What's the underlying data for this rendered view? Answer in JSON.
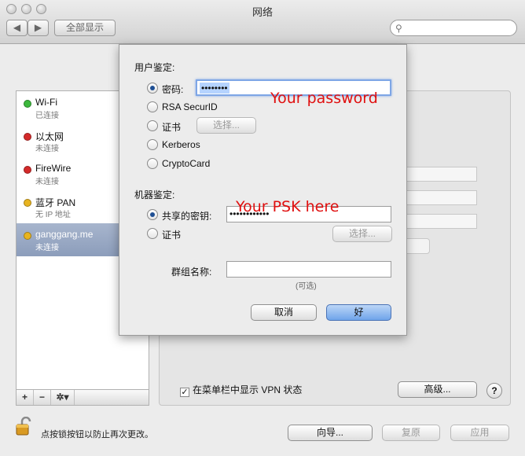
{
  "window": {
    "title": "网络"
  },
  "toolbar": {
    "back_label": "◀",
    "forward_label": "▶",
    "show_all_label": "全部显示",
    "search_value": ""
  },
  "services": [
    {
      "name": "Wi-Fi",
      "status": "已连接",
      "color": "#3cb83c"
    },
    {
      "name": "以太网",
      "status": "未连接",
      "color": "#d42a2a"
    },
    {
      "name": "FireWire",
      "status": "未连接",
      "color": "#d42a2a"
    },
    {
      "name": "蓝牙 PAN",
      "status": "无 IP 地址",
      "color": "#e8b420"
    },
    {
      "name": "ganggang.me",
      "status": "未连接",
      "color": "#e8b420"
    }
  ],
  "sidebar_buttons": {
    "add": "+",
    "remove": "−",
    "action": "✲▾"
  },
  "sheet": {
    "user_auth_label": "用户鉴定:",
    "password_option": "密码:",
    "password_value": "••••••••",
    "rsa_option": "RSA SecurID",
    "cert_option": "证书",
    "select_button": "选择...",
    "kerberos_option": "Kerberos",
    "cryptocard_option": "CryptoCard",
    "machine_auth_label": "机器鉴定:",
    "shared_secret_option": "共享的密钥:",
    "shared_secret_value": "••••••••••••",
    "machine_cert_option": "证书",
    "machine_select_button": "选择...",
    "group_name_label": "群组名称:",
    "group_name_value": "",
    "optional_hint": "(可选)",
    "cancel_button": "取消",
    "ok_button": "好"
  },
  "annotations": {
    "password_note": "Your password",
    "psk_note": "Your PSK here"
  },
  "footer": {
    "show_vpn_checkbox_label": "在菜单栏中显示 VPN 状态",
    "show_vpn_checked": true,
    "advanced_button": "高级...",
    "help_button": "?",
    "lock_text": "点按锁按钮以防止再次更改。",
    "assist_button": "向导...",
    "revert_button": "复原",
    "apply_button": "应用"
  }
}
